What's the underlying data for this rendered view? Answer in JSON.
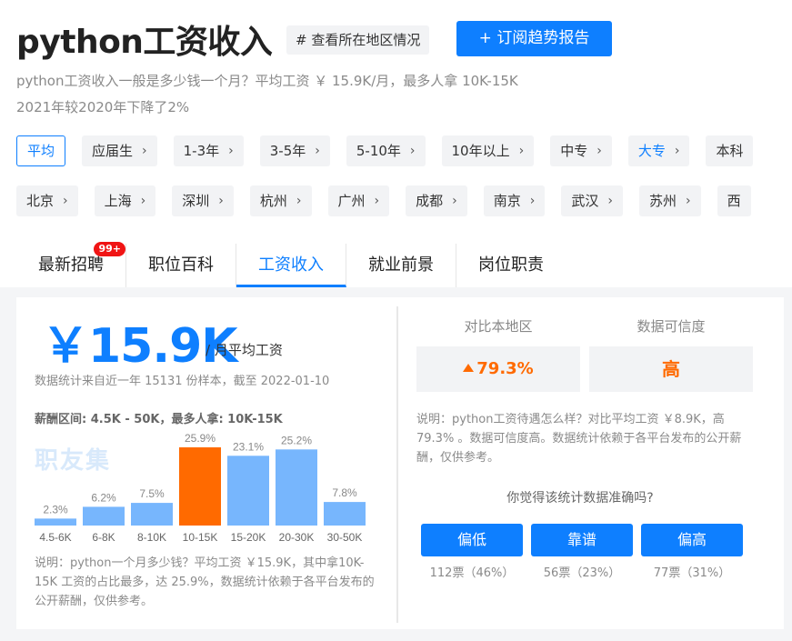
{
  "header": {
    "title": "python工资收入",
    "region_button": "# 查看所在地区情况",
    "subscribe_button": "+ 订阅趋势报告",
    "desc_line1": "python工资收入一般是多少钱一个月？平均工资 ￥ 15.9K/月，最多人拿 10K-15K",
    "desc_line2": "2021年较2020年下降了2%"
  },
  "experience_filters": [
    {
      "label": "平均",
      "state": "selected",
      "chevron": ""
    },
    {
      "label": "应届生",
      "state": "",
      "chevron": "›"
    },
    {
      "label": "1-3年",
      "state": "",
      "chevron": "›"
    },
    {
      "label": "3-5年",
      "state": "",
      "chevron": "›"
    },
    {
      "label": "5-10年",
      "state": "",
      "chevron": "›"
    },
    {
      "label": "10年以上",
      "state": "",
      "chevron": "›"
    },
    {
      "label": "中专",
      "state": "",
      "chevron": "›"
    },
    {
      "label": "大专",
      "state": "highlight",
      "chevron": "›"
    },
    {
      "label": "本科",
      "state": "",
      "chevron": ""
    }
  ],
  "city_filters": [
    {
      "label": "北京",
      "chevron": "›"
    },
    {
      "label": "上海",
      "chevron": "›"
    },
    {
      "label": "深圳",
      "chevron": "›"
    },
    {
      "label": "杭州",
      "chevron": "›"
    },
    {
      "label": "广州",
      "chevron": "›"
    },
    {
      "label": "成都",
      "chevron": "›"
    },
    {
      "label": "南京",
      "chevron": "›"
    },
    {
      "label": "武汉",
      "chevron": "›"
    },
    {
      "label": "苏州",
      "chevron": "›"
    },
    {
      "label": "西",
      "chevron": ""
    }
  ],
  "tabs": [
    {
      "label": "最新招聘",
      "badge": "99+",
      "active": false
    },
    {
      "label": "职位百科",
      "badge": "",
      "active": false
    },
    {
      "label": "工资收入",
      "badge": "",
      "active": true
    },
    {
      "label": "就业前景",
      "badge": "",
      "active": false
    },
    {
      "label": "岗位职责",
      "badge": "",
      "active": false
    }
  ],
  "salary": {
    "amount": "￥15.9K",
    "unit": "/ 月平均工资",
    "stat_note": "数据统计来自近一年 15131 份样本，截至 2022-01-10",
    "range_text": "薪酬区间: 4.5K - 50K，最多人拿:  10K-15K",
    "watermark": "职友集",
    "note": "说明：python一个月多少钱？平均工资 ￥15.9K，其中拿10K-15K 工资的占比最多，达 25.9%，数据统计依赖于各平台发布的公开薪酬，仅供参考。"
  },
  "chart_data": {
    "type": "bar",
    "categories": [
      "4.5-6K",
      "6-8K",
      "8-10K",
      "10-15K",
      "15-20K",
      "20-30K",
      "30-50K"
    ],
    "values": [
      2.3,
      6.2,
      7.5,
      25.9,
      23.1,
      25.2,
      7.8
    ],
    "labels": [
      "2.3%",
      "6.2%",
      "7.5%",
      "25.9%",
      "23.1%",
      "25.2%",
      "7.8%"
    ],
    "highlight_index": 3,
    "bar_color": "#77b6fd",
    "highlight_color": "#ff6a00",
    "ylim": [
      0,
      25.9
    ]
  },
  "comparison": {
    "local_header": "对比本地区",
    "reliability_header": "数据可信度",
    "local_value": "79.3%",
    "reliability_value": "高",
    "note": "说明：python工资待遇怎么样？对比平均工资 ￥8.9K，高 79.3% 。数据可信度高。数据统计依赖于各平台发布的公开薪酬，仅供参考。",
    "question": "你觉得该统计数据准确吗?"
  },
  "votes": [
    {
      "label": "偏低",
      "count": "112票（46%）"
    },
    {
      "label": "靠谱",
      "count": "56票（23%）"
    },
    {
      "label": "偏高",
      "count": "77票（31%）"
    }
  ],
  "colors": {
    "accent": "#0e7fff",
    "highlight": "#ff6a00",
    "badge": "#f01414"
  }
}
